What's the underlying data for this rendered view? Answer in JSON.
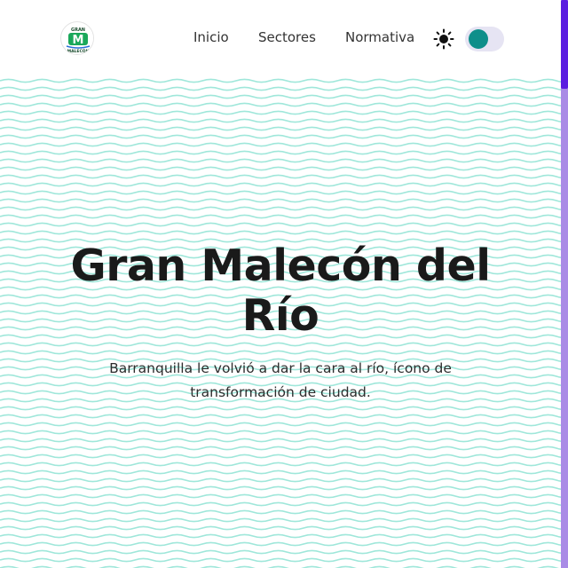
{
  "header": {
    "logo": {
      "icon": "gran-malecon-logo",
      "top_text": "GRAN",
      "letter": "M",
      "bottom_text": "MALECÓN"
    },
    "nav_links": [
      {
        "label": "Inicio"
      },
      {
        "label": "Sectores"
      },
      {
        "label": "Normativa"
      }
    ],
    "theme_icon": "sun-icon",
    "theme_toggle_state": "on"
  },
  "hero": {
    "title_line1": "Gran Malecón del",
    "title_line2": "Río",
    "subtitle_line1": "Barranquilla le volvió a dar la cara al río, ícono de",
    "subtitle_line2": "transformación de ciudad.",
    "background_pattern": "wavy-lines"
  },
  "colors": {
    "wave": "#9fe7da",
    "toggle_knob": "#0e8f8a",
    "toggle_track": "#e6e4f3",
    "scrollbar_thumb": "#5a1ee0",
    "scrollbar_track": "#a98be6",
    "logo_green": "#1aa85a",
    "text": "#1a1a1a"
  }
}
